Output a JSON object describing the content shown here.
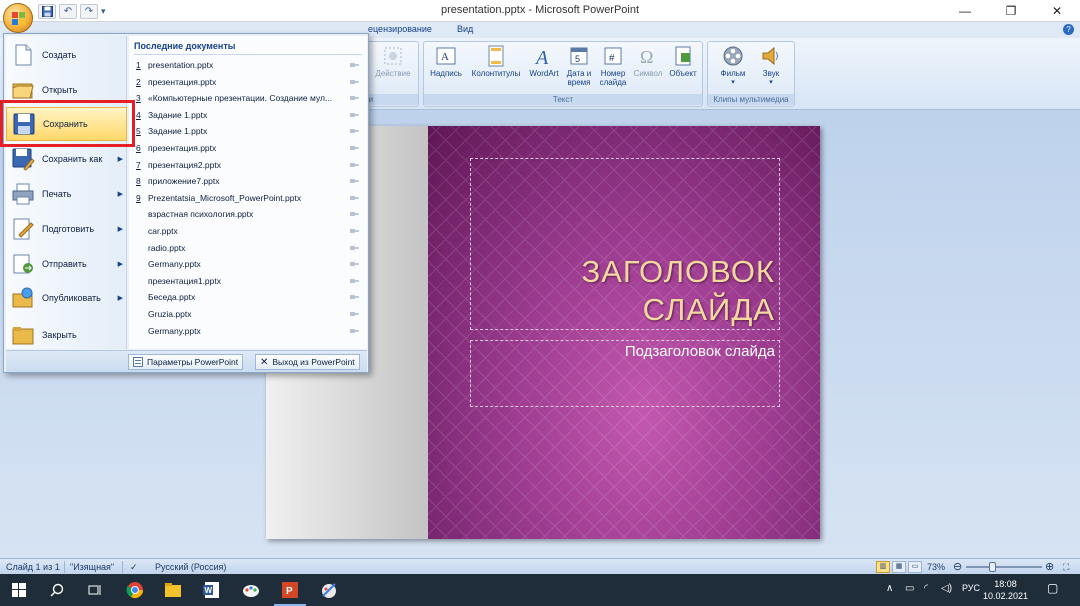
{
  "window": {
    "title": "presentation.pptx - Microsoft PowerPoint",
    "controls": [
      "—",
      "❐",
      "✕"
    ]
  },
  "qat": {
    "save_icon": "save-icon",
    "undo_icon": "undo-icon",
    "redo_icon": "redo-icon",
    "customize": "▾"
  },
  "tabs": [
    {
      "label": "ецензирование"
    },
    {
      "label": "Вид"
    }
  ],
  "ribbon": {
    "partial_group_label": "зи",
    "partial_button_label": "Действие",
    "text_group": {
      "label": "Текст",
      "buttons": [
        "Надпись",
        "Колонтитулы",
        "WordArt",
        "Дата и время",
        "Номер слайда",
        "Символ",
        "Объект"
      ]
    },
    "media_group": {
      "label": "Клипы мультимедиа",
      "buttons": [
        "Фильм",
        "Звук"
      ]
    }
  },
  "office_menu": {
    "items": [
      {
        "label": "Создать",
        "icon": "new-document-icon",
        "has_arrow": false
      },
      {
        "label": "Открыть",
        "icon": "open-folder-icon",
        "has_arrow": false
      },
      {
        "label": "Сохранить",
        "icon": "save-floppy-icon",
        "has_arrow": false,
        "selected": true
      },
      {
        "label": "Сохранить как",
        "icon": "save-as-icon",
        "has_arrow": true
      },
      {
        "label": "Печать",
        "icon": "print-icon",
        "has_arrow": true
      },
      {
        "label": "Подготовить",
        "icon": "prepare-icon",
        "has_arrow": true
      },
      {
        "label": "Отправить",
        "icon": "send-icon",
        "has_arrow": true
      },
      {
        "label": "Опубликовать",
        "icon": "publish-icon",
        "has_arrow": true
      },
      {
        "label": "Закрыть",
        "icon": "close-folder-icon",
        "has_arrow": false
      }
    ],
    "recent_header": "Последние документы",
    "recent": [
      {
        "num": "1",
        "name": "presentation.pptx"
      },
      {
        "num": "2",
        "name": "презентация.pptx"
      },
      {
        "num": "3",
        "name": "«Компьютерные презентации. Создание мул..."
      },
      {
        "num": "4",
        "name": "Задание  1.pptx"
      },
      {
        "num": "5",
        "name": "Задание  1.pptx"
      },
      {
        "num": "6",
        "name": "презентация.pptx"
      },
      {
        "num": "7",
        "name": "презентация2.pptx"
      },
      {
        "num": "8",
        "name": "приложение7.pptx"
      },
      {
        "num": "9",
        "name": "Prezentatsia_Microsoft_PowerPoint.pptx"
      },
      {
        "num": "",
        "name": "взрастная психология.pptx"
      },
      {
        "num": "",
        "name": "car.pptx"
      },
      {
        "num": "",
        "name": "radio.pptx"
      },
      {
        "num": "",
        "name": "Germany.pptx"
      },
      {
        "num": "",
        "name": "презентация1.pptx"
      },
      {
        "num": "",
        "name": "Беседа.pptx"
      },
      {
        "num": "",
        "name": "Gruzia.pptx"
      },
      {
        "num": "",
        "name": "Germany.pptx"
      }
    ],
    "options_button": "Параметры PowerPoint",
    "exit_button": "Выход из PowerPoint"
  },
  "slide": {
    "title_line1": "ЗАГОЛОВОК",
    "title_line2": "СЛАЙДА",
    "subtitle": "Подзаголовок слайда"
  },
  "status": {
    "slide_info": "Слайд 1 из 1",
    "theme": "\"Изящная\"",
    "language": "Русский (Россия)",
    "zoom": "73%",
    "zoom_fraction": 0.35
  },
  "taskbar": {
    "lang": "РУС",
    "time": "18:08",
    "date": "10.02.2021"
  },
  "colors": {
    "highlight": "#e41f26",
    "slide_purple": "#9a3a8e",
    "title_gold": "#f5d9a0"
  }
}
